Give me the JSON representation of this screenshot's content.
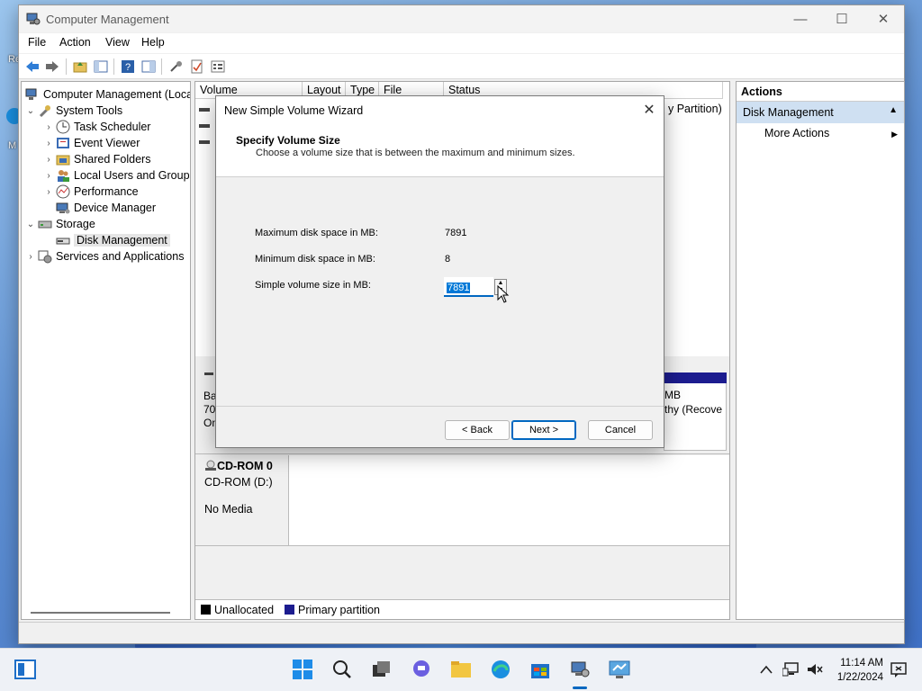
{
  "window": {
    "title": "Computer Management",
    "minimize": "—",
    "maximize": "☐",
    "close": "✕"
  },
  "menu": [
    "File",
    "Action",
    "View",
    "Help"
  ],
  "tree": [
    {
      "label": "Computer Management (Local",
      "level": 0,
      "chevron": ""
    },
    {
      "label": "System Tools",
      "level": 1,
      "chevron": "⌄"
    },
    {
      "label": "Task Scheduler",
      "level": 2,
      "chevron": "›"
    },
    {
      "label": "Event Viewer",
      "level": 2,
      "chevron": "›"
    },
    {
      "label": "Shared Folders",
      "level": 2,
      "chevron": "›"
    },
    {
      "label": "Local Users and Groups",
      "level": 2,
      "chevron": "›"
    },
    {
      "label": "Performance",
      "level": 2,
      "chevron": "›"
    },
    {
      "label": "Device Manager",
      "level": 2,
      "chevron": ""
    },
    {
      "label": "Storage",
      "level": 1,
      "chevron": "⌄"
    },
    {
      "label": "Disk Management",
      "level": 2,
      "chevron": "",
      "selected": true
    },
    {
      "label": "Services and Applications",
      "level": 1,
      "chevron": "›"
    }
  ],
  "volume_columns": [
    "Volume",
    "Layout",
    "Type",
    "File System",
    "Status"
  ],
  "volume_partial_status": "y Partition)",
  "disk0_partial": {
    "line1": "Bas",
    "line2": "70.",
    "line3": "On"
  },
  "recovery_partial": {
    "line1": "MB",
    "line2": "thy (Recove"
  },
  "cdrom": {
    "name": "CD-ROM 0",
    "type": "CD-ROM (D:)",
    "media": "No Media"
  },
  "legend": [
    {
      "label": "Unallocated",
      "color": "#000000"
    },
    {
      "label": "Primary partition",
      "color": "#1c1c8f"
    }
  ],
  "actions": {
    "header": "Actions",
    "selected": "Disk Management",
    "item": "More Actions"
  },
  "wizard": {
    "title": "New Simple Volume Wizard",
    "heading": "Specify Volume Size",
    "subheading": "Choose a volume size that is between the maximum and minimum sizes.",
    "max_label": "Maximum disk space in MB:",
    "max_value": "7891",
    "min_label": "Minimum disk space in MB:",
    "min_value": "8",
    "size_label": "Simple volume size in MB:",
    "size_value": "7891",
    "back": "< Back",
    "next": "Next >",
    "cancel": "Cancel"
  },
  "desktop": {
    "partial_text_1": "Re",
    "partial_text_2": "M"
  },
  "taskbar": {
    "time": "11:14 AM",
    "date": "1/22/2024"
  },
  "colors": {
    "accent": "#0067c0",
    "selection": "#cfe0f2",
    "primary_partition": "#1c1c8f"
  }
}
